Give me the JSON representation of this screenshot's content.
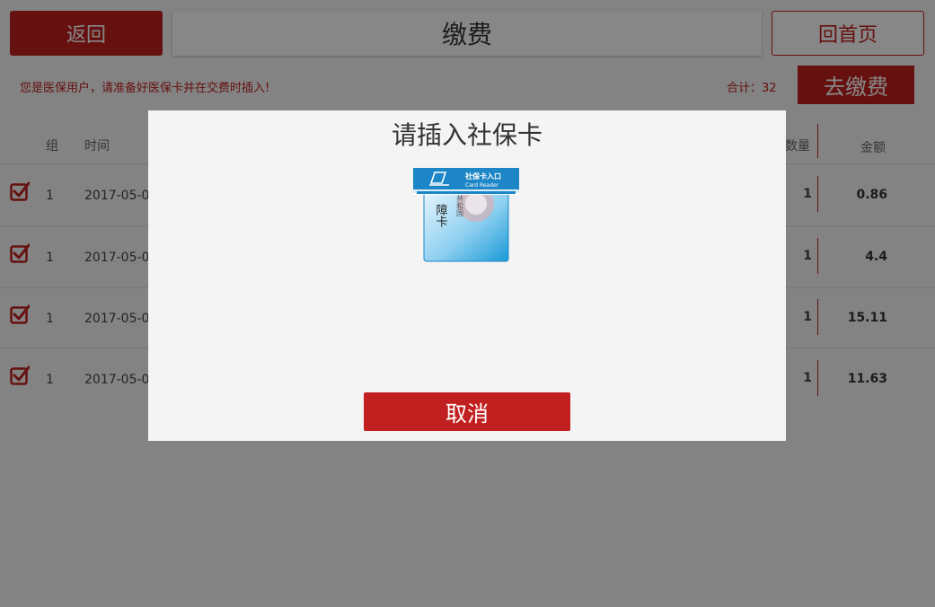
{
  "header": {
    "back_label": "返回",
    "title": "缴费",
    "home_label": "回首页"
  },
  "notice": {
    "message": "您是医保用户，请准备好医保卡并在交费时插入!",
    "total_text": "合计：32",
    "pay_label": "去缴费"
  },
  "table": {
    "columns": {
      "group": "组",
      "time": "时间",
      "quantity": "数量",
      "amount": "金额"
    },
    "rows": [
      {
        "checked": true,
        "group": "1",
        "time": "2017-05-0",
        "quantity": "1",
        "amount": "0.86"
      },
      {
        "checked": true,
        "group": "1",
        "time": "2017-05-0",
        "quantity": "1",
        "amount": "4.4"
      },
      {
        "checked": true,
        "group": "1",
        "time": "2017-05-0",
        "quantity": "1",
        "amount": "15.11"
      },
      {
        "checked": true,
        "group": "1",
        "time": "2017-05-0",
        "quantity": "1",
        "amount": "11.63"
      }
    ]
  },
  "modal": {
    "title": "请插入社保卡",
    "card_reader_label_cn": "社保卡入口",
    "card_reader_label_en": "Card Reader",
    "card_text": "共和国",
    "card_text2": "障卡",
    "cancel_label": "取消"
  },
  "colors": {
    "accent": "#c0201f",
    "overlay": "rgba(0,0,0,0.47)"
  },
  "icons": {
    "checkbox": "checkbox-checked-icon",
    "card": "social-security-card-icon"
  }
}
